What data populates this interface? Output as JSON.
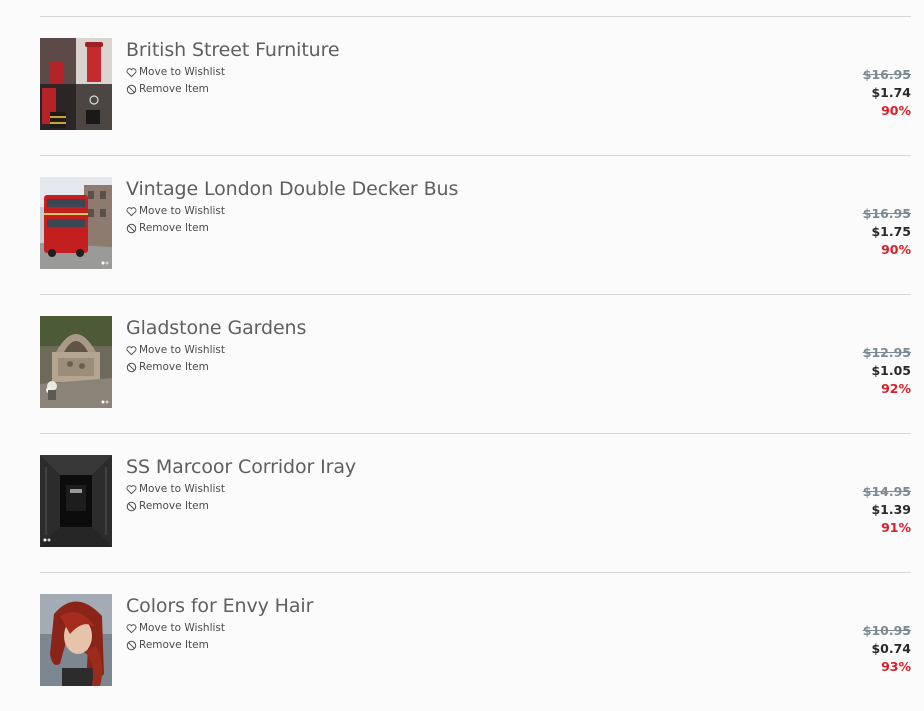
{
  "cart": {
    "items": [
      {
        "title": "British Street Furniture",
        "wishlist_label": "Move to Wishlist",
        "remove_label": "Remove Item",
        "original_price": "$16.95",
        "sale_price": "$1.74",
        "discount": "90%"
      },
      {
        "title": "Vintage London Double Decker Bus",
        "wishlist_label": "Move to Wishlist",
        "remove_label": "Remove Item",
        "original_price": "$16.95",
        "sale_price": "$1.75",
        "discount": "90%"
      },
      {
        "title": "Gladstone Gardens",
        "wishlist_label": "Move to Wishlist",
        "remove_label": "Remove Item",
        "original_price": "$12.95",
        "sale_price": "$1.05",
        "discount": "92%"
      },
      {
        "title": "SS Marcoor Corridor Iray",
        "wishlist_label": "Move to Wishlist",
        "remove_label": "Remove Item",
        "original_price": "$14.95",
        "sale_price": "$1.39",
        "discount": "91%"
      },
      {
        "title": "Colors for Envy Hair",
        "wishlist_label": "Move to Wishlist",
        "remove_label": "Remove Item",
        "original_price": "$10.95",
        "sale_price": "$0.74",
        "discount": "93%"
      }
    ]
  },
  "icons": {
    "wishlist": "heart-outline-icon",
    "remove": "ban-icon"
  },
  "colors": {
    "title": "#5f5f5f",
    "original_price": "#7b8a93",
    "sale_price": "#2a2a2a",
    "discount": "#d6212b",
    "divider": "#d6d6d6"
  }
}
